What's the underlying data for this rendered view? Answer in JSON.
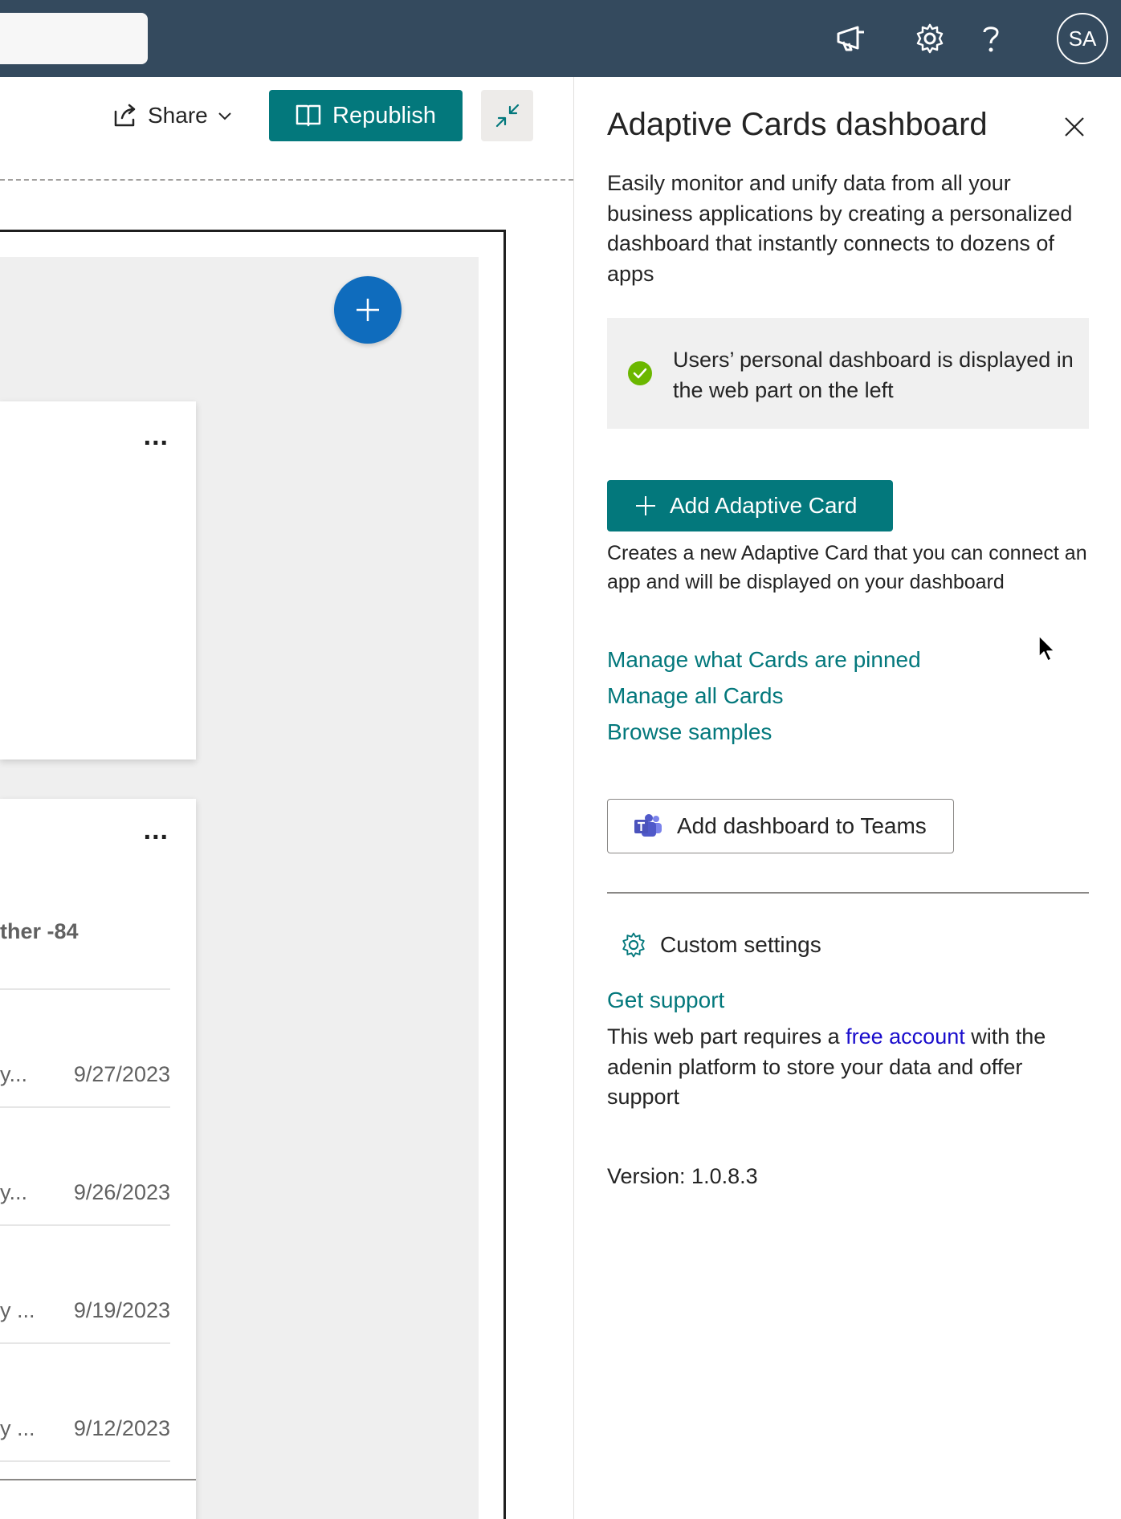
{
  "topbar": {
    "icons": [
      "megaphone-icon",
      "gear-icon",
      "help-icon"
    ],
    "avatar_initials": "SA",
    "background": "#344a5e"
  },
  "command_bar": {
    "share_label": "Share",
    "republish_label": "Republish",
    "accent": "#03787c"
  },
  "canvas": {
    "cards": [
      {
        "menu": "..."
      },
      {
        "menu": "...",
        "summary": "ther -84",
        "rows": [
          {
            "text": "y...",
            "date": "9/27/2023"
          },
          {
            "text": "y...",
            "date": "9/26/2023"
          },
          {
            "text": "y ...",
            "date": "9/19/2023"
          },
          {
            "text": "y ...",
            "date": "9/12/2023"
          }
        ]
      }
    ]
  },
  "panel": {
    "title": "Adaptive Cards dashboard",
    "description": "Easily monitor and unify data from all your business applications by creating a personalized dashboard that instantly connects to dozens of apps",
    "info_message": "Users’ personal dashboard is displayed in the web part on the left",
    "add_card_label": "Add Adaptive Card",
    "add_card_description": "Creates a new Adaptive Card that you can connect an app and will be displayed on your dashboard",
    "links": [
      "Manage what Cards are pinned",
      "Manage all Cards",
      "Browse samples"
    ],
    "teams_button_label": "Add dashboard to Teams",
    "custom_settings_label": "Custom settings",
    "get_support_label": "Get support",
    "support_text_before": "This web part requires a ",
    "support_link": "free account",
    "support_text_after": " with the adenin platform to store your data and offer support",
    "version_label": "Version: 1.0.8.3"
  }
}
